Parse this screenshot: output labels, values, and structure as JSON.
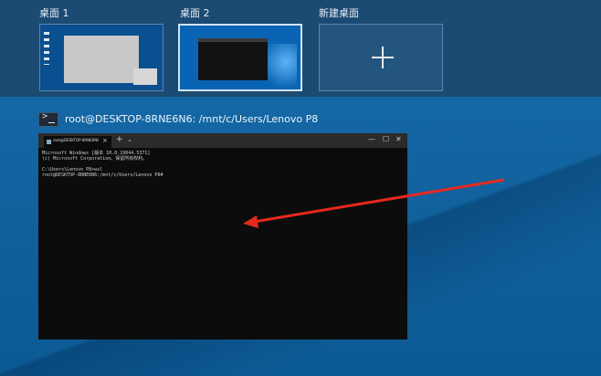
{
  "desktops": [
    {
      "label": "桌面 1"
    },
    {
      "label": "桌面 2"
    },
    {
      "label": "新建桌面"
    }
  ],
  "window": {
    "title": "root@DESKTOP-8RNE6N6: /mnt/c/Users/Lenovo P8",
    "tab_title": "root@DESKTOP-8RNE6N6: /mnt/c/Users/Lenovo P8",
    "tab_close": "×",
    "new_tab": "+",
    "new_tab_dropdown": "⌄",
    "minimize": "—",
    "maximize": "☐",
    "close": "✕"
  },
  "terminal": {
    "lines": [
      "Microsoft Windows [版本 10.0.19044.5371]",
      "(c) Microsoft Corporation。保留所有权利。",
      "",
      "C:\\Users\\Lenovo P8>wsl",
      "root@DESKTOP-8RNE6N6:/mnt/c/Users/Lenovo P8#"
    ]
  },
  "annotation": {
    "color": "#e8281e"
  },
  "colors": {
    "strip": "#1b4a72",
    "desktop": "#0f5e99",
    "terminal_bg": "#0c0c0c",
    "selected_border": "#cfe3f5"
  }
}
